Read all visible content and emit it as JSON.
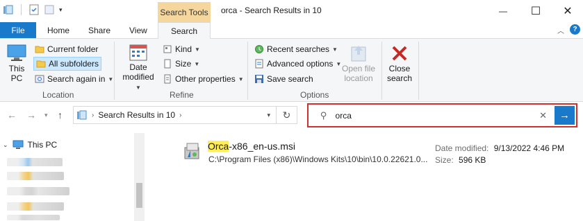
{
  "window": {
    "title": "orca - Search Results in 10",
    "context_tab": "Search Tools",
    "minimize": "—",
    "maximize": "☐",
    "close": "✕"
  },
  "tabs": {
    "file": "File",
    "home": "Home",
    "share": "Share",
    "view": "View",
    "search": "Search"
  },
  "ribbon": {
    "location": {
      "this_pc": "This PC",
      "current_folder": "Current folder",
      "all_subfolders": "All subfolders",
      "search_again_in": "Search again in",
      "group_label": "Location"
    },
    "refine": {
      "date_modified": "Date modified",
      "kind": "Kind",
      "size": "Size",
      "other_properties": "Other properties",
      "group_label": "Refine"
    },
    "options": {
      "recent_searches": "Recent searches",
      "advanced_options": "Advanced options",
      "save_search": "Save search",
      "open_file_location": "Open file location",
      "group_label": "Options"
    },
    "close_search": "Close search"
  },
  "address": {
    "path": "Search Results in 10",
    "search_value": "orca"
  },
  "navpane": {
    "this_pc": "This PC"
  },
  "result": {
    "name_highlight": "Orca",
    "name_rest": "-x86_en-us.msi",
    "path": "C:\\Program Files (x86)\\Windows Kits\\10\\bin\\10.0.22621.0...",
    "date_label": "Date modified:",
    "date_value": "9/13/2022 4:46 PM",
    "size_label": "Size:",
    "size_value": "596 KB"
  },
  "colors": {
    "accent": "#1979ca",
    "context_tab": "#f5d79e",
    "search_highlight_border": "#d32f2f",
    "match_highlight": "#ffee58"
  }
}
